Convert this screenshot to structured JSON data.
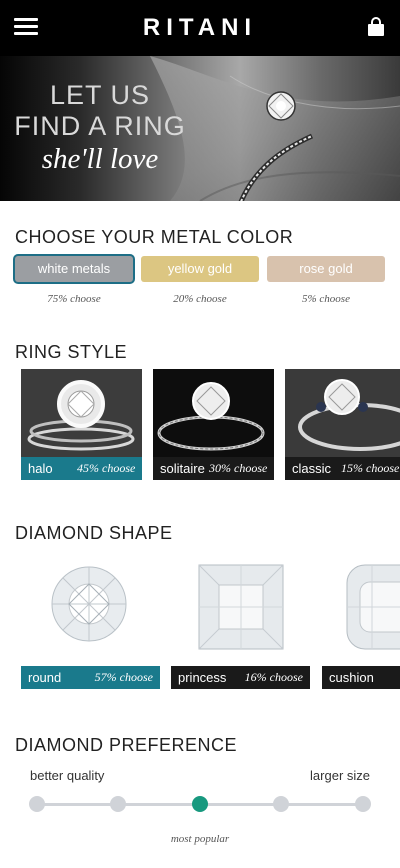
{
  "header": {
    "logo": "RITANI",
    "menu_icon": "hamburger-menu-icon",
    "bag_icon": "shopping-bag-icon"
  },
  "hero": {
    "line1": "LET US",
    "line2": "FIND A RING",
    "line3": "she'll love"
  },
  "metal": {
    "title": "CHOOSE YOUR METAL COLOR",
    "options": [
      {
        "label": "white metals",
        "pct": "75% choose",
        "color": "#9b9ea2",
        "selected": true
      },
      {
        "label": "yellow gold",
        "pct": "20% choose",
        "color": "#dcc682",
        "selected": false
      },
      {
        "label": "rose gold",
        "pct": "5% choose",
        "color": "#d8c2ad",
        "selected": false
      }
    ]
  },
  "ring_style": {
    "title": "RING STYLE",
    "items": [
      {
        "name": "halo",
        "pct": "45% choose",
        "bar_color": "#1a7a8c",
        "selected": true
      },
      {
        "name": "solitaire",
        "pct": "30% choose",
        "bar_color": "#1a1a1a",
        "selected": false
      },
      {
        "name": "classic",
        "pct": "15% choose",
        "bar_color": "#1a1a1a",
        "selected": false
      }
    ]
  },
  "diamond_shape": {
    "title": "DIAMOND SHAPE",
    "items": [
      {
        "name": "round",
        "pct": "57% choose",
        "bar_color": "#1a7a8c",
        "selected": true
      },
      {
        "name": "princess",
        "pct": "16% choose",
        "bar_color": "#1a1a1a",
        "selected": false
      },
      {
        "name": "cushion",
        "pct": "",
        "bar_color": "#1a1a1a",
        "selected": false
      }
    ]
  },
  "preference": {
    "title": "DIAMOND PREFERENCE",
    "left_label": "better quality",
    "right_label": "larger size",
    "caption": "most popular",
    "steps": 5,
    "selected_step": 3,
    "accent": "#18997f"
  }
}
